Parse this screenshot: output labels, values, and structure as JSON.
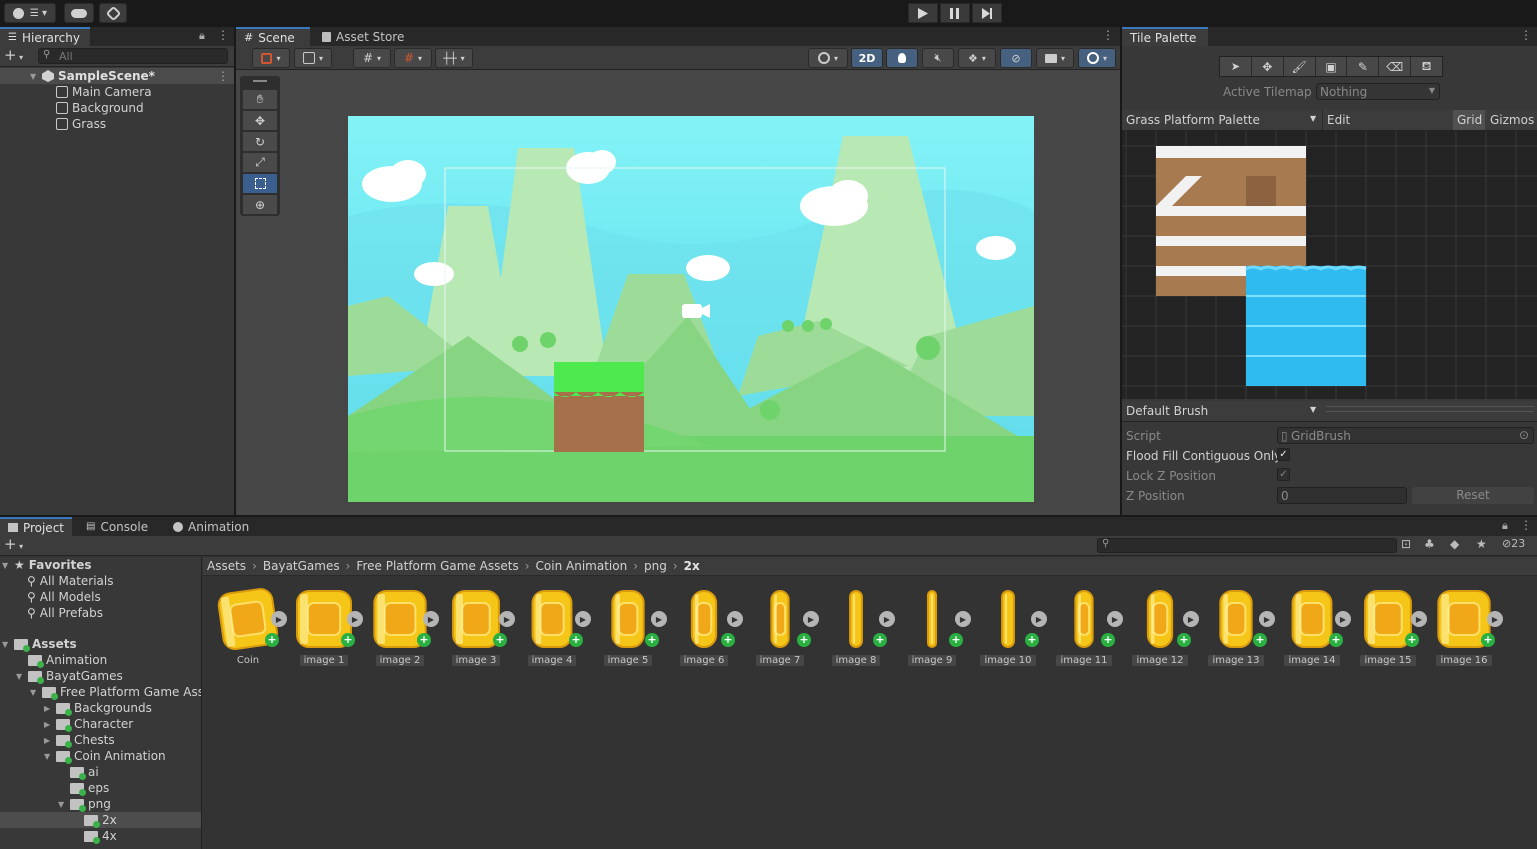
{
  "hierarchy": {
    "tab": "Hierarchy",
    "search_placeholder": "All",
    "scene": "SampleScene*",
    "objects": [
      "Main Camera",
      "Background",
      "Grass"
    ]
  },
  "scene_view": {
    "tabs": [
      "Scene",
      "Asset Store"
    ],
    "mode_2d": "2D"
  },
  "tile_palette": {
    "tab": "Tile Palette",
    "active_tilemap_label": "Active Tilemap",
    "active_tilemap_value": "Nothing",
    "palette_name": "Grass Platform Palette",
    "edit_label": "Edit",
    "grid_label": "Grid",
    "gizmos_label": "Gizmos",
    "brush": "Default Brush",
    "script_label": "Script",
    "script_value": "GridBrush",
    "flood_fill_label": "Flood Fill Contiguous Only",
    "lock_z_label": "Lock Z Position",
    "z_position_label": "Z Position",
    "z_position_value": "0",
    "reset_label": "Reset"
  },
  "bottom": {
    "tabs": [
      "Project",
      "Console",
      "Animation"
    ],
    "count": "23",
    "favorites": {
      "title": "Favorites",
      "items": [
        "All Materials",
        "All Models",
        "All Prefabs"
      ]
    },
    "assets_title": "Assets",
    "tree": [
      {
        "label": "Animation",
        "indent": 1
      },
      {
        "label": "BayatGames",
        "indent": 1
      },
      {
        "label": "Free Platform Game Asset",
        "indent": 2
      },
      {
        "label": "Backgrounds",
        "indent": 3
      },
      {
        "label": "Character",
        "indent": 3
      },
      {
        "label": "Chests",
        "indent": 3
      },
      {
        "label": "Coin Animation",
        "indent": 3
      },
      {
        "label": "ai",
        "indent": 4
      },
      {
        "label": "eps",
        "indent": 4
      },
      {
        "label": "png",
        "indent": 4
      },
      {
        "label": "2x",
        "indent": 5
      },
      {
        "label": "4x",
        "indent": 5
      }
    ],
    "breadcrumb": [
      "Assets",
      "BayatGames",
      "Free Platform Game Assets",
      "Coin Animation",
      "png",
      "2x"
    ],
    "assets": [
      "Coin",
      "image 1",
      "image 2",
      "image 3",
      "image 4",
      "image 5",
      "image 6",
      "image 7",
      "image 8",
      "image 9",
      "image 10",
      "image 11",
      "image 12",
      "image 13",
      "image 14",
      "image 15",
      "image 16"
    ],
    "coin_widths": [
      1,
      1,
      0.95,
      0.85,
      0.72,
      0.58,
      0.45,
      0.32,
      0.22,
      0.15,
      0.22,
      0.32,
      0.45,
      0.58,
      0.72,
      0.85,
      0.95
    ]
  },
  "colors": {
    "accent": "#3a79bb",
    "sky": "#7ef0f6",
    "grass": "#6ed36a",
    "coin": "#f5c518"
  }
}
